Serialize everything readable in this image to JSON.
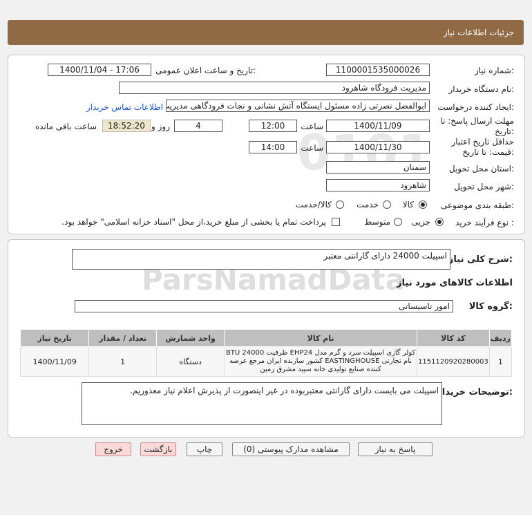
{
  "header": {
    "title": "جزئیات اطلاعات نیاز"
  },
  "form": {
    "need_number_label": "شماره نیاز:",
    "need_number": "1100001535000026",
    "announce_label": "تاریخ و ساعت اعلان عمومی:",
    "announce_value": "1400/11/04 - 17:06",
    "buyer_org_label": "نام دستگاه خریدار:",
    "buyer_org": "مدیریت فرودگاه شاهرود",
    "creator_label": "ایجاد کننده درخواست:",
    "creator": "ابوالفضل نصرتی زاده مسئول ایستگاه آتش نشانی و نجات فرودگاهی مدیریت فرودگاه شاهرود",
    "contact_link": "اطلاعات تماس خریدار",
    "reply_deadline_label_1": "مهلت ارسال پاسخ: تا",
    "reply_deadline_label_2": "تاریخ:",
    "reply_date": "1400/11/09",
    "time_label": "ساعت",
    "reply_time": "12:00",
    "days_value": "4",
    "days_label": "روز و",
    "remaining_time": "18:52:20",
    "remaining_label": "ساعت باقی مانده",
    "validity_label_1": "حداقل تاریخ اعتبار",
    "validity_label_2": "قیمت: تا تاریخ:",
    "validity_date": "1400/11/30",
    "validity_time": "14:00",
    "province_label": "استان محل تحویل:",
    "province": "سمنان",
    "city_label": "شهر محل تحویل:",
    "city": "شاهرود",
    "category_label": "طبقه بندی موضوعی:",
    "category_options": [
      "کالا",
      "خدمت",
      "کالا/خدمت"
    ],
    "process_label": "نوع فرآیند خرید :",
    "process_options": [
      "جزیی",
      "متوسط"
    ],
    "payment_note": "پرداخت تمام یا بخشی از مبلغ خرید،از محل \"اسناد خزانه اسلامی\" خواهد بود."
  },
  "summary": {
    "title_label": "شرح کلی نیاز:",
    "title_value": "اسپیلت 24000 دارای گارانتی معتبر",
    "goods_info_title": "اطلاعات کالاهای مورد نیاز",
    "group_label": "گروه کالا:",
    "group_value": "امور تاسیساتی"
  },
  "table": {
    "headers": [
      "ردیف",
      "کد کالا",
      "نام کالا",
      "واحد شمارش",
      "تعداد / مقدار",
      "تاریخ نیاز"
    ],
    "rows": [
      {
        "row": "1",
        "code": "1151120920280003",
        "name": "کولر گازی اسپیلت سرد و گرم مدل EHP24 ظرفیت BTU 24000 نام تجارتی EASTINGHOUSE کشور سازنده ایران مرجع عرضه کننده صنایع تولیدی خانه سپید مشرق زمین",
        "unit": "دستگاه",
        "qty": "1",
        "date": "1400/11/09"
      }
    ]
  },
  "buyer_notes": {
    "label": "توضیحات خریدار:",
    "text": "اسپیلت می بایست دارای گارانتی معتبربوده در غیر اینصورت از پذیرش اعلام نیاز معذوریم."
  },
  "buttons": {
    "reply": "پاسخ به نیاز",
    "view_docs": "مشاهده مدارک پیوستی (0)",
    "print": "چاپ",
    "back": "بازگشت",
    "exit": "خروج"
  },
  "watermark": {
    "text": "ParsNamadData"
  }
}
